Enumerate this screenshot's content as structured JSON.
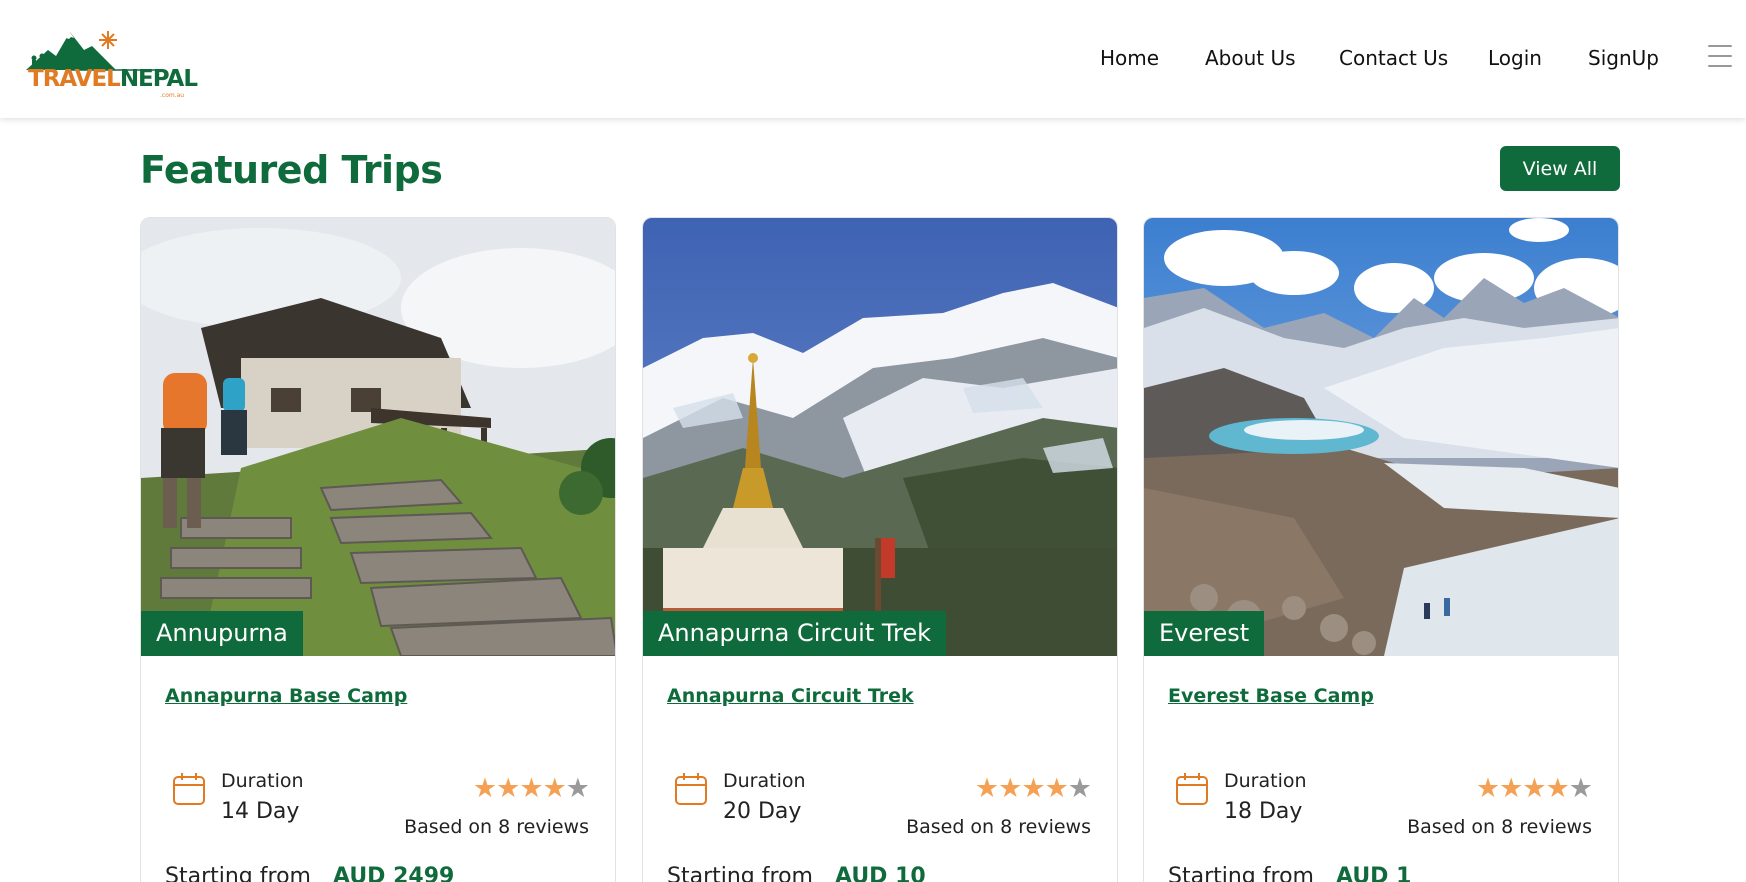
{
  "brand": {
    "name_part1": "TRAVEL",
    "name_part2": "NEPAL",
    "domain": ".com.au",
    "colors": {
      "primary": "#0f6b3c",
      "accent": "#e07b24",
      "star": "#f4a156"
    }
  },
  "nav": {
    "items": [
      {
        "label": "Home"
      },
      {
        "label": "About Us"
      },
      {
        "label": "Contact Us"
      },
      {
        "label": "Login"
      },
      {
        "label": "SignUp"
      }
    ],
    "menu_icon": "hamburger-menu-icon"
  },
  "section": {
    "title": "Featured Trips",
    "view_all_label": "View All"
  },
  "trips": [
    {
      "tag": "Annupurna",
      "title": "Annapurna Base Camp",
      "duration_label": "Duration",
      "duration_value": "14 Day",
      "rating": 4,
      "rating_max": 5,
      "reviews": "Based on 8 reviews",
      "price_label": "Starting from",
      "price": "AUD 2499"
    },
    {
      "tag": "Annapurna Circuit Trek",
      "title": "Annapurna Circuit Trek",
      "duration_label": "Duration",
      "duration_value": "20 Day",
      "rating": 4,
      "rating_max": 5,
      "reviews": "Based on 8 reviews",
      "price_label": "Starting from",
      "price": "AUD 10"
    },
    {
      "tag": "Everest",
      "title": "Everest Base Camp",
      "duration_label": "Duration",
      "duration_value": "18 Day",
      "rating": 4,
      "rating_max": 5,
      "reviews": "Based on 8 reviews",
      "price_label": "Starting from",
      "price": "AUD 1"
    }
  ]
}
